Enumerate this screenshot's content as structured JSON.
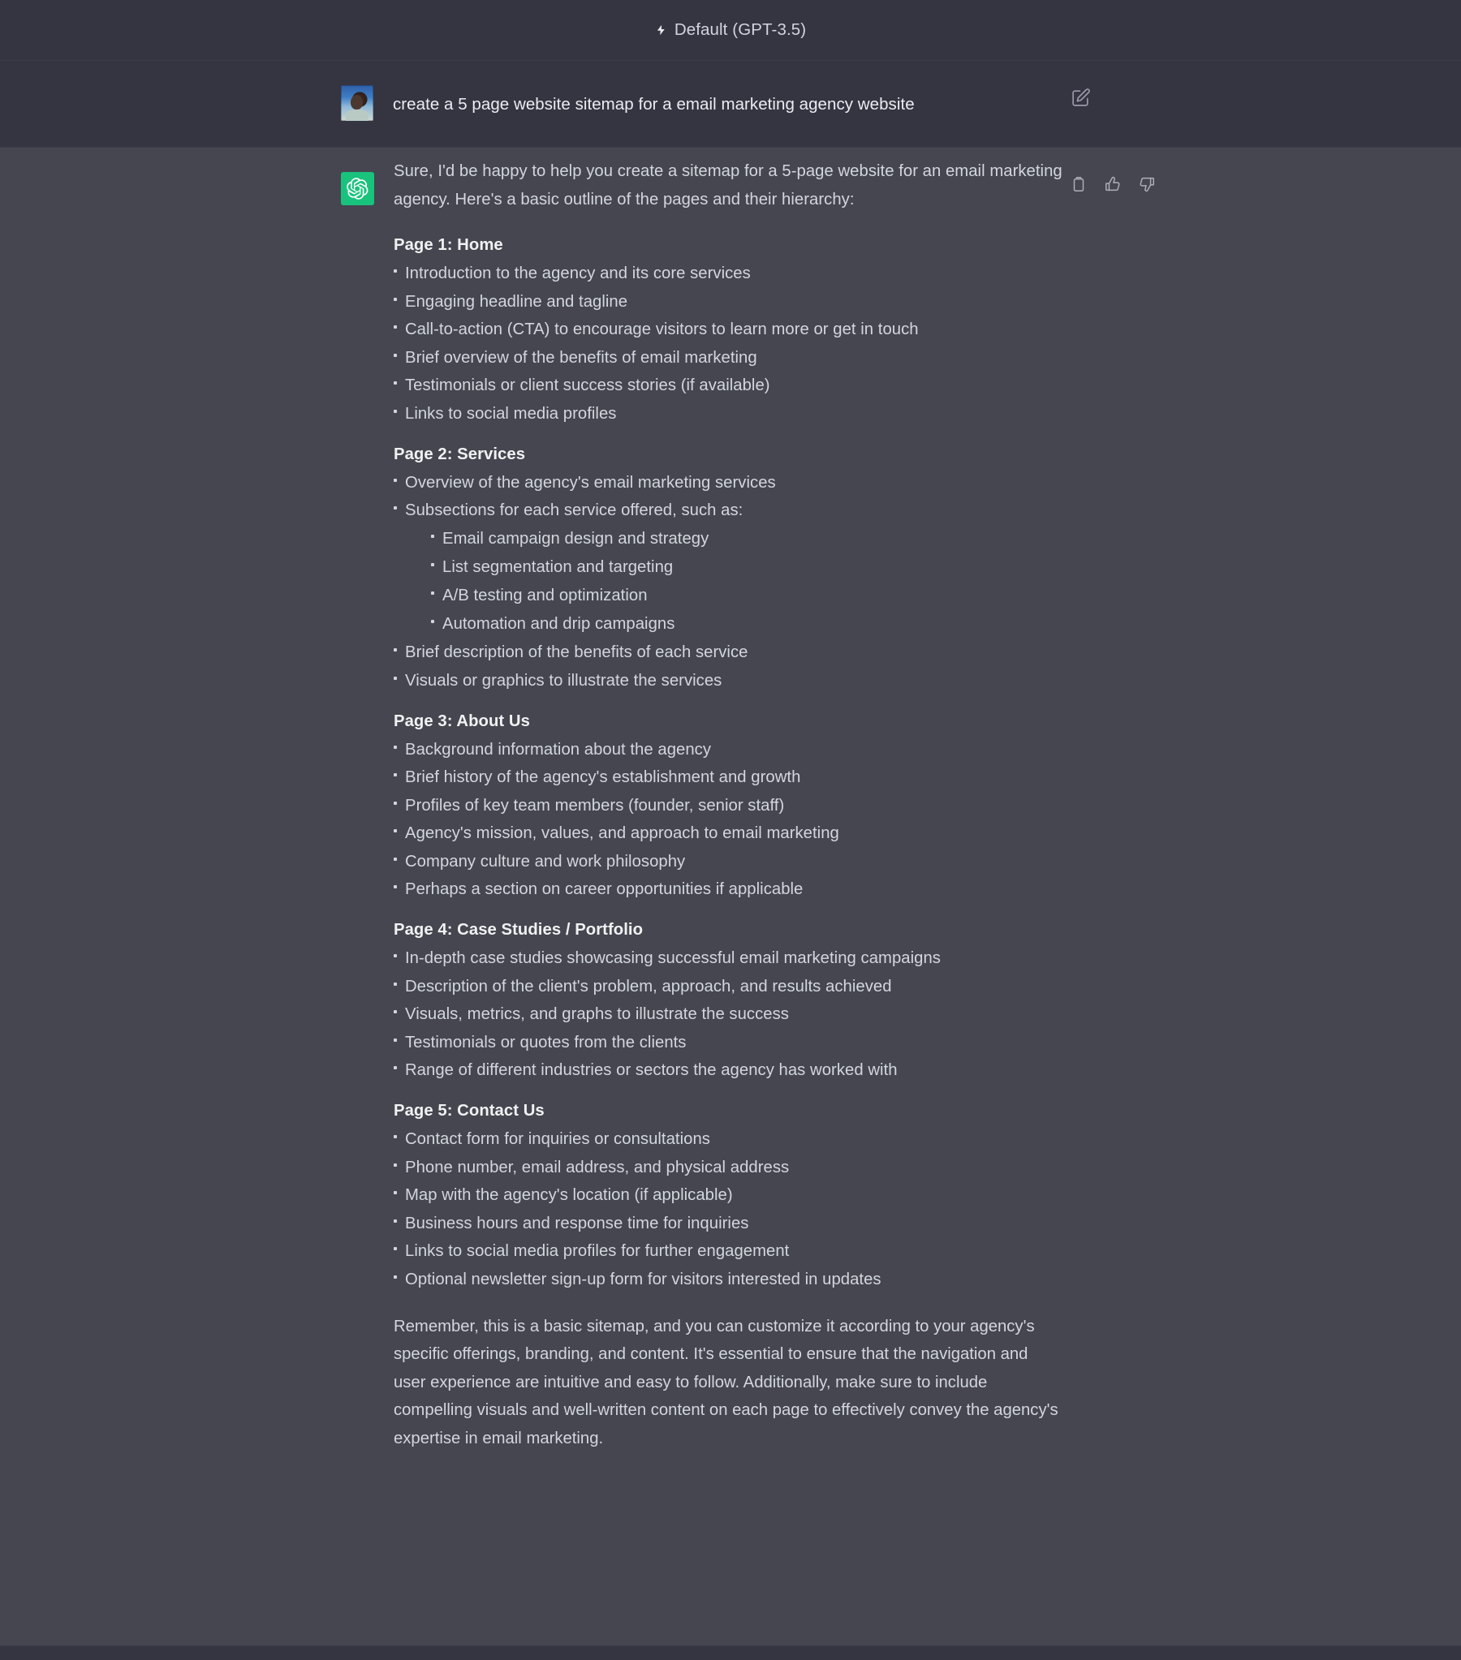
{
  "header": {
    "model_label": "Default (GPT-3.5)",
    "bolt_icon": "lightning-bolt-icon"
  },
  "user_message": {
    "text": "create a 5 page website sitemap for a email marketing agency website",
    "avatar": "user-photo-avatar",
    "edit_icon": "edit-pencil-icon"
  },
  "assistant_message": {
    "avatar": "chatgpt-logo-icon",
    "actions": [
      {
        "name": "copy-icon",
        "label": "Copy"
      },
      {
        "name": "thumbs-up-icon",
        "label": "Good response"
      },
      {
        "name": "thumbs-down-icon",
        "label": "Bad response"
      }
    ],
    "intro": "Sure, I'd be happy to help you create a sitemap for a 5-page website for an email marketing agency. Here's a basic outline of the pages and their hierarchy:",
    "sections": [
      {
        "title": "Page 1: Home",
        "items": [
          {
            "text": "Introduction to the agency and its core services"
          },
          {
            "text": "Engaging headline and tagline"
          },
          {
            "text": "Call-to-action (CTA) to encourage visitors to learn more or get in touch"
          },
          {
            "text": "Brief overview of the benefits of email marketing"
          },
          {
            "text": "Testimonials or client success stories (if available)"
          },
          {
            "text": "Links to social media profiles"
          }
        ]
      },
      {
        "title": "Page 2: Services",
        "items": [
          {
            "text": "Overview of the agency's email marketing services"
          },
          {
            "text": "Subsections for each service offered, such as:",
            "sub": [
              "Email campaign design and strategy",
              "List segmentation and targeting",
              "A/B testing and optimization",
              "Automation and drip campaigns"
            ]
          },
          {
            "text": "Brief description of the benefits of each service"
          },
          {
            "text": "Visuals or graphics to illustrate the services"
          }
        ]
      },
      {
        "title": "Page 3: About Us",
        "items": [
          {
            "text": "Background information about the agency"
          },
          {
            "text": "Brief history of the agency's establishment and growth"
          },
          {
            "text": "Profiles of key team members (founder, senior staff)"
          },
          {
            "text": "Agency's mission, values, and approach to email marketing"
          },
          {
            "text": "Company culture and work philosophy"
          },
          {
            "text": "Perhaps a section on career opportunities if applicable"
          }
        ]
      },
      {
        "title": "Page 4: Case Studies / Portfolio",
        "items": [
          {
            "text": "In-depth case studies showcasing successful email marketing campaigns"
          },
          {
            "text": "Description of the client's problem, approach, and results achieved"
          },
          {
            "text": "Visuals, metrics, and graphs to illustrate the success"
          },
          {
            "text": "Testimonials or quotes from the clients"
          },
          {
            "text": "Range of different industries or sectors the agency has worked with"
          }
        ]
      },
      {
        "title": "Page 5: Contact Us",
        "items": [
          {
            "text": "Contact form for inquiries or consultations"
          },
          {
            "text": "Phone number, email address, and physical address"
          },
          {
            "text": "Map with the agency's location (if applicable)"
          },
          {
            "text": "Business hours and response time for inquiries"
          },
          {
            "text": "Links to social media profiles for further engagement"
          },
          {
            "text": "Optional newsletter sign-up form for visitors interested in updates"
          }
        ]
      }
    ],
    "closing": "Remember, this is a basic sitemap, and you can customize it according to your agency's specific offerings, branding, and content. It's essential to ensure that the navigation and user experience are intuitive and easy to follow. Additionally, make sure to include compelling visuals and well-written content on each page to effectively convey the agency's expertise in email marketing."
  },
  "colors": {
    "header_bg": "#343541",
    "user_bg": "#343541",
    "assistant_bg": "#45464f",
    "accent_green": "#19c37d",
    "text_primary": "#ececf1",
    "text_body": "#d3d6de"
  }
}
